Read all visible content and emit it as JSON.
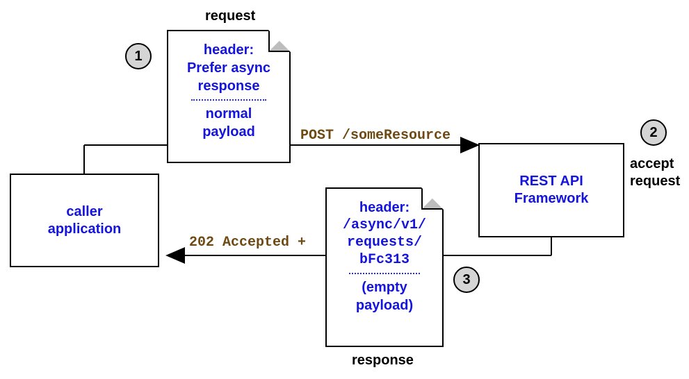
{
  "nodes": {
    "caller": "caller\napplication",
    "framework": "REST API\nFramework"
  },
  "docs": {
    "request": {
      "title": "request",
      "headerLabel": "header:",
      "headerValue": "Prefer async\nresponse",
      "payload": "normal\npayload"
    },
    "response": {
      "title": "response",
      "headerLabel": "header:",
      "headerValue": "/async/v1/\nrequests/\nbFc313",
      "payload": "(empty\npayload)"
    }
  },
  "arrows": {
    "post": "POST /someResource",
    "accepted": "202 Accepted +"
  },
  "sideLabel": "accept\nrequest",
  "steps": {
    "s1": "1",
    "s2": "2",
    "s3": "3"
  }
}
